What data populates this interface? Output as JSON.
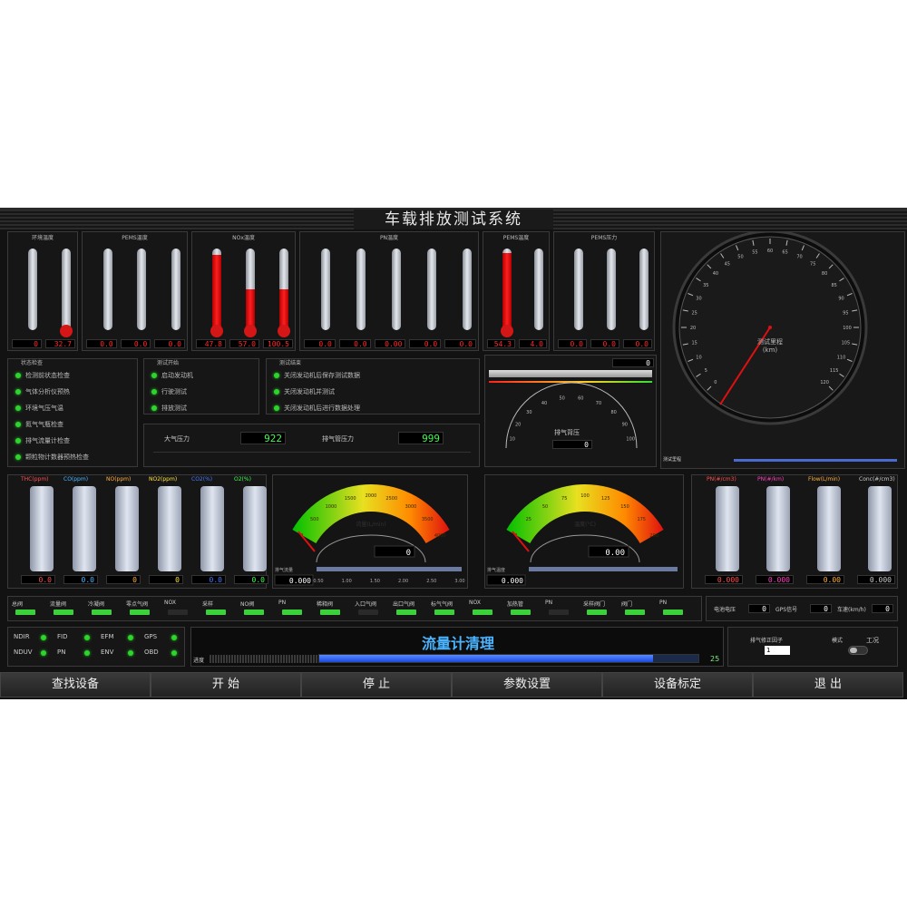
{
  "title": "车载排放测试系统",
  "thermo_groups": [
    {
      "title": "环境温度",
      "cols": [
        {
          "label": "",
          "value": "0",
          "fill": 0.0
        },
        {
          "label": "",
          "value": "32.7",
          "fill": 0.05
        }
      ]
    },
    {
      "title": "PEMS温度",
      "cols": [
        {
          "label": "",
          "value": "0.0",
          "fill": 0.0
        },
        {
          "label": "",
          "value": "0.0",
          "fill": 0.0
        },
        {
          "label": "",
          "value": "0.0",
          "fill": 0.0
        }
      ]
    },
    {
      "title": "NOx温度",
      "cols": [
        {
          "label": "",
          "value": "47.8",
          "fill": 0.92
        },
        {
          "label": "",
          "value": "57.0",
          "fill": 0.5
        },
        {
          "label": "",
          "value": "100.5",
          "fill": 0.5
        }
      ]
    },
    {
      "title": "PN温度",
      "cols": [
        {
          "label": "",
          "value": "0.0",
          "fill": 0.0
        },
        {
          "label": "",
          "value": "0.0",
          "fill": 0.0
        },
        {
          "label": "",
          "value": "0.00",
          "fill": 0.0
        },
        {
          "label": "",
          "value": "0.0",
          "fill": 0.0
        },
        {
          "label": "",
          "value": "0.0",
          "fill": 0.0
        }
      ]
    },
    {
      "title": "PEMS温度",
      "cols": [
        {
          "label": "",
          "value": "54.3",
          "fill": 0.95
        },
        {
          "label": "",
          "value": "4.0",
          "fill": 0.0
        }
      ]
    },
    {
      "title": "PEMS压力",
      "cols": [
        {
          "label": "",
          "value": "0.0",
          "fill": 0.0
        },
        {
          "label": "",
          "value": "0.0",
          "fill": 0.0
        },
        {
          "label": "",
          "value": "0.0",
          "fill": 0.0
        }
      ]
    }
  ],
  "status_panel": {
    "title": "状态检查",
    "items": [
      "检测前状态检查",
      "气体分析仪预热",
      "环境气压气温",
      "氮气气瓶检查",
      "排气流量计检查",
      "颗粒物计数器预热检查"
    ]
  },
  "test_panel": {
    "title": "测试开始",
    "items": [
      "启动发动机",
      "行驶测试",
      "排放测试"
    ]
  },
  "after_panel": {
    "title": "测试结束",
    "items": [
      "关闭发动机后保存测试数据",
      "关闭发动机并测试",
      "关闭发动机后进行数据处理"
    ]
  },
  "pressure": {
    "atm_label": "大气压力",
    "atm_value": "922",
    "exh_label": "排气管压力",
    "exh_value": "999"
  },
  "small_gauge": {
    "center_label": "排气背压",
    "value": "0",
    "top_value": "0",
    "ticks": [
      "10",
      "20",
      "30",
      "40",
      "50",
      "60",
      "70",
      "80",
      "90",
      "100"
    ]
  },
  "speedo": {
    "label1": "测试里程",
    "label2": "(km)",
    "ticks": [
      "0",
      "5",
      "10",
      "15",
      "20",
      "25",
      "30",
      "35",
      "40",
      "45",
      "50",
      "55",
      "60",
      "65",
      "70",
      "75",
      "80",
      "85",
      "90",
      "95",
      "100",
      "105",
      "110",
      "115",
      "120"
    ],
    "value_deg": 34
  },
  "left_bars": {
    "channels": [
      {
        "name": "THC(ppm)",
        "color": "#ff5050",
        "value": "0.0"
      },
      {
        "name": "CO(ppm)",
        "color": "#4ab8ff",
        "value": "0.0"
      },
      {
        "name": "NO(ppm)",
        "color": "#ffb040",
        "value": "0"
      },
      {
        "name": "NO2(ppm)",
        "color": "#ffe040",
        "value": "0"
      },
      {
        "name": "CO2(%)",
        "color": "#4a7aff",
        "value": "0.0"
      },
      {
        "name": "O2(%)",
        "color": "#40ff50",
        "value": "0.0"
      }
    ]
  },
  "right_bars": {
    "channels": [
      {
        "name": "PN(#/cm3)",
        "color": "#ff5050",
        "value": "0.000"
      },
      {
        "name": "PN(#/km)",
        "color": "#ff40c0",
        "value": "0.000"
      },
      {
        "name": "Flow(L/min)",
        "color": "#ffb040",
        "value": "0.00"
      },
      {
        "name": "Conc(#/cm3)",
        "color": "#cccccc",
        "value": "0.000"
      }
    ]
  },
  "arc_gauges": [
    {
      "label": "流量(L/min)",
      "value": "0",
      "sub_label": "排气流量",
      "sub_value": "0.000",
      "ticks": [
        "0",
        "500",
        "1000",
        "1500",
        "2000",
        "2500",
        "3000",
        "3500",
        "4000"
      ],
      "scale": [
        "0.50",
        "1.00",
        "1.50",
        "2.00",
        "2.50",
        "3.00"
      ]
    },
    {
      "label": "温度(°C)",
      "value": "0.00",
      "sub_label": "排气温度",
      "sub_value": "0.000",
      "ticks": [
        "0",
        "25",
        "50",
        "75",
        "100",
        "125",
        "150",
        "175",
        "200"
      ],
      "scale": []
    }
  ],
  "valve_row": [
    "总阀",
    "流量阀",
    "冷凝阀",
    "零点气阀",
    "NOX",
    "采样",
    "NO阀",
    "PN",
    "稀释阀",
    "入口气阀",
    "出口气阀",
    "标气气阀",
    "NOX",
    "加热管",
    "PN",
    "采样阀门",
    "阀门",
    "PN"
  ],
  "right_status": [
    {
      "label": "电池电压",
      "value": "0"
    },
    {
      "label": "GPS信号",
      "value": "0"
    },
    {
      "label": "车速(km/h)",
      "value": "0"
    }
  ],
  "devices": [
    {
      "label": "NDIR",
      "on": true
    },
    {
      "label": "FID",
      "on": true
    },
    {
      "label": "EFM",
      "on": true
    },
    {
      "label": "GPS",
      "on": true
    },
    {
      "label": "NDUV",
      "on": true
    },
    {
      "label": "PN",
      "on": true
    },
    {
      "label": "ENV",
      "on": true
    },
    {
      "label": "OBD",
      "on": true
    }
  ],
  "message": "流量计清理",
  "progress": {
    "label": "进度",
    "value": 25,
    "percent": 0.88
  },
  "side_ctrl": {
    "factor_label": "排气修正因子",
    "factor_value": "1",
    "mode_label": "模式",
    "mode_option": "工况"
  },
  "buttons": [
    "查找设备",
    "开 始",
    "停 止",
    "参数设置",
    "设备标定",
    "退 出"
  ]
}
